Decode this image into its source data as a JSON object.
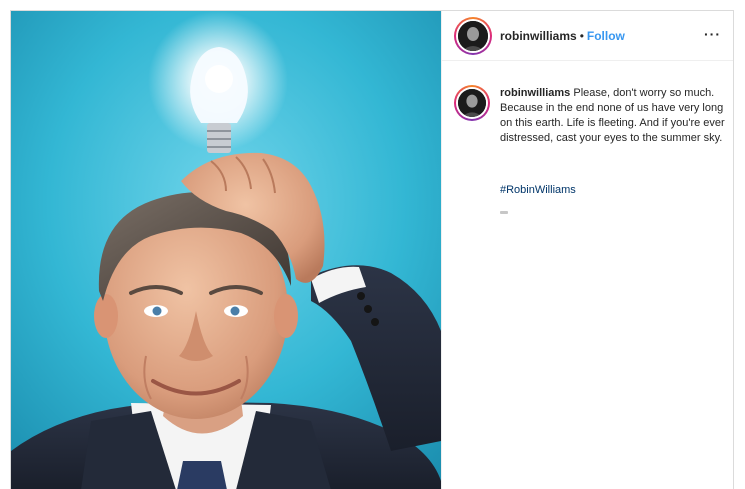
{
  "post": {
    "media": {
      "subject": "Man in dark suit holding a glowing light bulb on top of his head against a blue background",
      "background_color": "#2fb5d2"
    },
    "header": {
      "username": "robinwilliams",
      "separator": "•",
      "follow_label": "Follow",
      "more_label": "···"
    },
    "caption": {
      "username": "robinwilliams",
      "text": "Please, don't worry so much. Because in the end none of us have very long on this earth. Life is fleeting. And if you're ever distressed, cast your eyes to the summer sky.",
      "hashtag": "#RobinWilliams"
    },
    "colors": {
      "follow": "#3897f0",
      "hashtag": "#003569",
      "border": "#dbdbdb"
    }
  }
}
